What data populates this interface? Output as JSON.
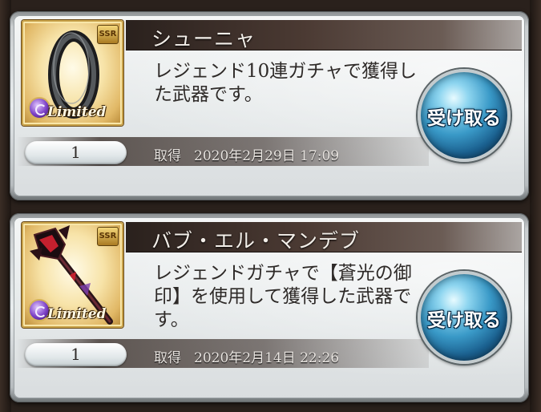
{
  "items": [
    {
      "name": "シューニャ",
      "description": "レジェンド10連ガチャで獲得した武器です。",
      "rarity": "SSR",
      "badge": "Limited",
      "icon": "zero-ring-weapon-icon",
      "quantity": "1",
      "acquired_label": "取得",
      "acquired_date": "2020年2月29日 17:09",
      "receive_label": "受け取る"
    },
    {
      "name": "バブ・エル・マンデブ",
      "description": "レジェンドガチャで【蒼光の御印】を使用して獲得した武器です。",
      "rarity": "SSR",
      "badge": "Limited",
      "icon": "dark-staff-weapon-icon",
      "quantity": "1",
      "acquired_label": "取得",
      "acquired_date": "2020年2月14日 22:26",
      "receive_label": "受け取る"
    }
  ],
  "colors": {
    "title_bar": "#3b2e28",
    "button_blue": "#3a9ac8",
    "card_frame": "#c9cdcf"
  }
}
